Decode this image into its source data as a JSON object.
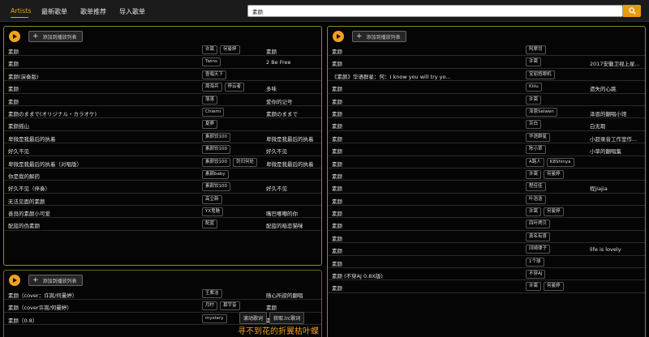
{
  "nav": {
    "tabs": [
      "Artists",
      "最新歌单",
      "歌单推荐",
      "导入歌单"
    ]
  },
  "search": {
    "value": "素颜"
  },
  "add_label": "添加到播放列表",
  "panels": [
    {
      "rows": [
        {
          "title": "素颜",
          "artists": [
            "许嵩",
            "何曼婷"
          ],
          "album": "素颜"
        },
        {
          "title": "素颜",
          "artists": [
            "Twins"
          ],
          "album": "2 Be Free"
        },
        {
          "title": "素颜(演奏版)",
          "artists": [
            "壹唱天下"
          ],
          "album": ""
        },
        {
          "title": "素颜",
          "artists": [
            "周海兵",
            "停云者"
          ],
          "album": "多味"
        },
        {
          "title": "素颜",
          "artists": [
            "落落"
          ],
          "album": "爱你的记号"
        },
        {
          "title": "素颜のままで(オリジナル・カラオケ)",
          "artists": [
            "Chiemi"
          ],
          "album": "素颜のままで"
        },
        {
          "title": "素颜摇山",
          "artists": [
            "夏夢"
          ],
          "album": ""
        },
        {
          "title": "卑微是我最后的执着",
          "artists": [
            "素颜饺100"
          ],
          "album": "卑微是我最后的执着"
        },
        {
          "title": "好久不见",
          "artists": [
            "素颜饺100"
          ],
          "album": "好久不见"
        },
        {
          "title": "卑微是我最后的执着（对唱版）",
          "artists": [
            "素颜饺100",
            "剑归何处"
          ],
          "album": "卑微是我最后的执着"
        },
        {
          "title": "你是我的解药",
          "artists": [
            "素颜baby"
          ],
          "album": ""
        },
        {
          "title": "好久不见（伴奏）",
          "artists": [
            "素颜饺100"
          ],
          "album": "好久不见"
        },
        {
          "title": "无法见面的素颜",
          "artists": [
            "高立新"
          ],
          "album": ""
        },
        {
          "title": "善良的素颜小可爱",
          "artists": [
            "YX鬼魅"
          ],
          "album": "嘴巴嘟嘟的你"
        },
        {
          "title": "配蓝的伪素颜",
          "artists": [
            "配蓝"
          ],
          "album": "配蓝的暗恋猫咪"
        }
      ]
    },
    {
      "rows": [
        {
          "title": "素颜",
          "artists": [
            "阿摩司"
          ],
          "album": ""
        },
        {
          "title": "素颜",
          "artists": [
            "许嵩"
          ],
          "album": "2017安徽卫视上星..."
        },
        {
          "title": "《素颜》华语群星：何：I know you will try yo...",
          "artists": [
            "宝丽悠眼机"
          ],
          "album": ""
        },
        {
          "title": "素颜",
          "artists": [
            "Kiiiu"
          ],
          "album": "遗失的心跳"
        },
        {
          "title": "素颜",
          "artists": [
            "许嵩"
          ],
          "album": ""
        },
        {
          "title": "素颜",
          "artists": [
            "泽恩Seiwen"
          ],
          "album": "泽恩的翻唱小馆"
        },
        {
          "title": "素颜",
          "artists": [
            "灰白"
          ],
          "album": "白无瑕"
        },
        {
          "title": "素颜",
          "artists": [
            "华语群星"
          ],
          "album": "小超录音工作室作..."
        },
        {
          "title": "素颜",
          "artists": [
            "陈小草"
          ],
          "album": "小草的翻唱集"
        },
        {
          "title": "素颜",
          "artists": [
            "A路人",
            "K8Shinya"
          ],
          "album": ""
        },
        {
          "title": "素颜",
          "artists": [
            "许嵩",
            "何曼婷"
          ],
          "album": ""
        },
        {
          "title": "素颜",
          "artists": [
            "程佳佳"
          ],
          "album": "程jiajia"
        },
        {
          "title": "素颜",
          "artists": [
            "叶浩浩"
          ],
          "album": ""
        },
        {
          "title": "素颜",
          "artists": [
            "许嵩",
            "何曼婷"
          ],
          "album": ""
        },
        {
          "title": "素颜",
          "artists": [
            "四叶拷贝"
          ],
          "album": ""
        },
        {
          "title": "素颜",
          "artists": [
            "真名有喜"
          ],
          "album": ""
        },
        {
          "title": "素颜",
          "artists": [
            "冈崎律子"
          ],
          "album": "life is lovely"
        },
        {
          "title": "素颜",
          "artists": [
            "1个球"
          ],
          "album": ""
        },
        {
          "title": "素颜 (不穿AJ 0.8X版)",
          "artists": [
            "不穿AJ"
          ],
          "album": ""
        },
        {
          "title": "素颜",
          "artists": [
            "许嵩",
            "何曼婷"
          ],
          "album": ""
        }
      ]
    },
    {
      "rows": [
        {
          "title": "素颜（cover：许嵩/何曼婷）",
          "artists": [
            "王紫洁"
          ],
          "album": "随心所欲的翻唱"
        },
        {
          "title": "素颜（cover许嵩/何曼婷）",
          "artists": [
            "月柠",
            "慕宇音"
          ],
          "album": "素颜"
        },
        {
          "title": "素颜（0.8）",
          "artists": [
            "mystery"
          ],
          "album": "素颜"
        }
      ]
    }
  ],
  "context_menu": {
    "scroll_label": "滚动歌词",
    "get_lrc_label": "获取.lrc歌词"
  },
  "lyric": "寻不到花的折翼枯叶蝶"
}
